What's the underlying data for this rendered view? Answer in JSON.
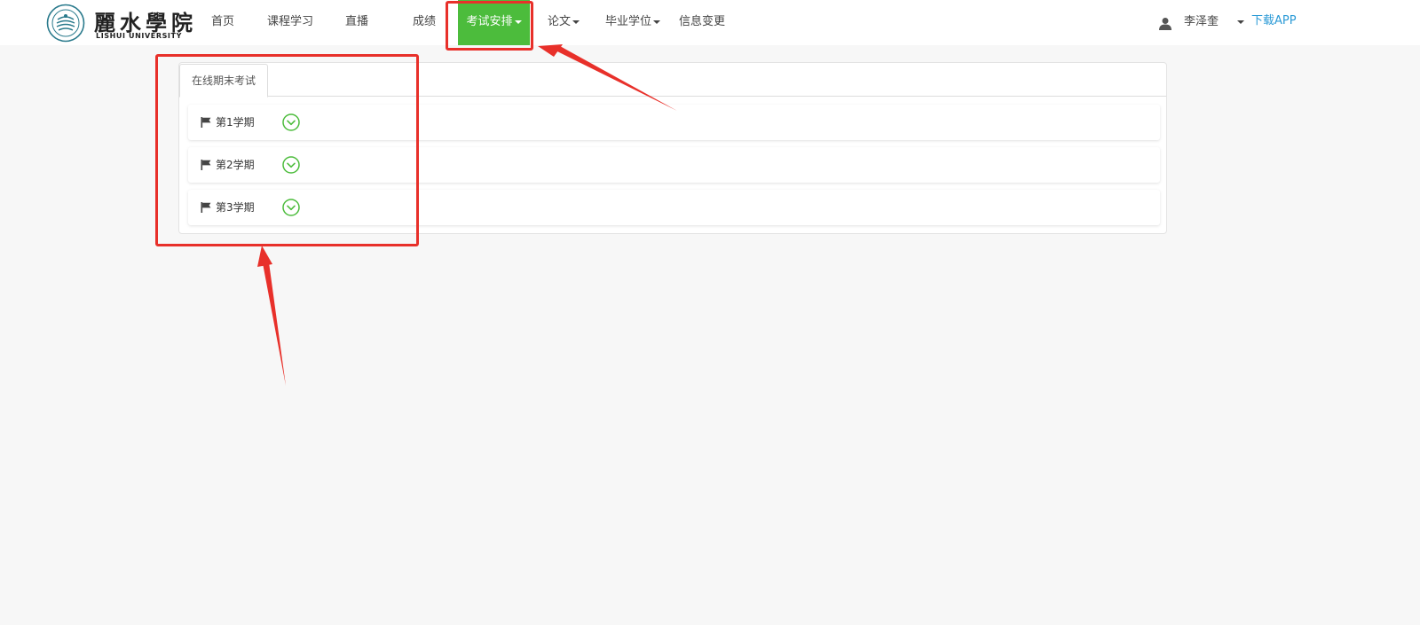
{
  "logo": {
    "name_cn": "麗水學院",
    "name_en": "LISHUI UNIVERSITY"
  },
  "nav": {
    "items": [
      {
        "label": "首页"
      },
      {
        "label": "课程学习"
      },
      {
        "label": "直播"
      },
      {
        "label": "成绩"
      },
      {
        "label": "考试安排",
        "active": true,
        "dropdown": true
      },
      {
        "label": "论文",
        "dropdown": true
      },
      {
        "label": "毕业学位",
        "dropdown": true
      },
      {
        "label": "信息变更"
      }
    ],
    "active_color": "#4cbc3c"
  },
  "user": {
    "icon": "user-icon",
    "name": "李泽奎",
    "download_label": "下载APP",
    "link_color": "#2b9ad6"
  },
  "exam": {
    "tab_label": "在线期末考试",
    "terms": [
      {
        "label": "第1学期",
        "icon": "flag-icon",
        "action_icon": "chevron-down-circle-icon"
      },
      {
        "label": "第2学期",
        "icon": "flag-icon",
        "action_icon": "chevron-down-circle-icon"
      },
      {
        "label": "第3学期",
        "icon": "flag-icon",
        "action_icon": "chevron-down-circle-icon"
      }
    ],
    "icon_color": "#4cbc3c"
  },
  "annotation": {
    "color": "#e8302a"
  }
}
